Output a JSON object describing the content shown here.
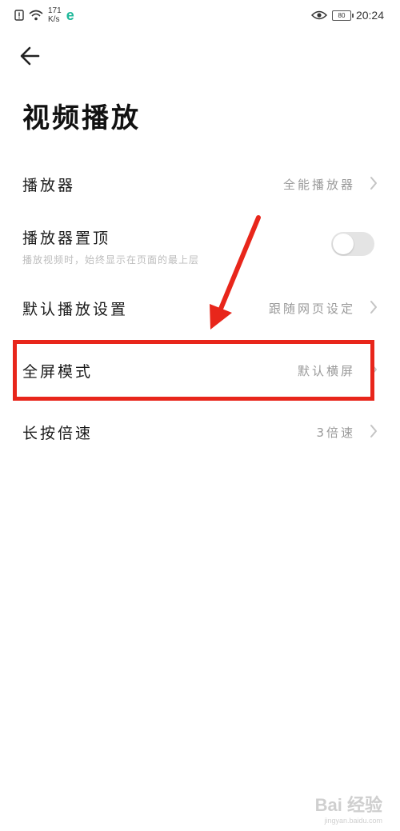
{
  "status_bar": {
    "net_speed_value": "171",
    "net_speed_unit": "K/s",
    "time": "20:24",
    "battery_level": "80"
  },
  "page": {
    "title": "视频播放"
  },
  "settings": [
    {
      "label": "播放器",
      "value": "全能播放器",
      "has_chevron": true
    },
    {
      "label": "播放器置顶",
      "subtitle": "播放视频时，始终显示在页面的最上层",
      "toggle_on": false
    },
    {
      "label": "默认播放设置",
      "value": "跟随网页设定",
      "has_chevron": true
    },
    {
      "label": "全屏模式",
      "value": "默认横屏",
      "has_chevron": true
    },
    {
      "label": "长按倍速",
      "value": "3倍速",
      "has_chevron": true
    }
  ],
  "annotation": {
    "highlight_color": "#e8261b"
  },
  "watermark": {
    "brand": "Bai 经验",
    "url": "jingyan.baidu.com"
  },
  "colors": {
    "background": "#ffffff",
    "secondary_text": "#9a9a9a",
    "toggle_off": "#e4e4e4",
    "app_accent": "#1fb89a"
  }
}
